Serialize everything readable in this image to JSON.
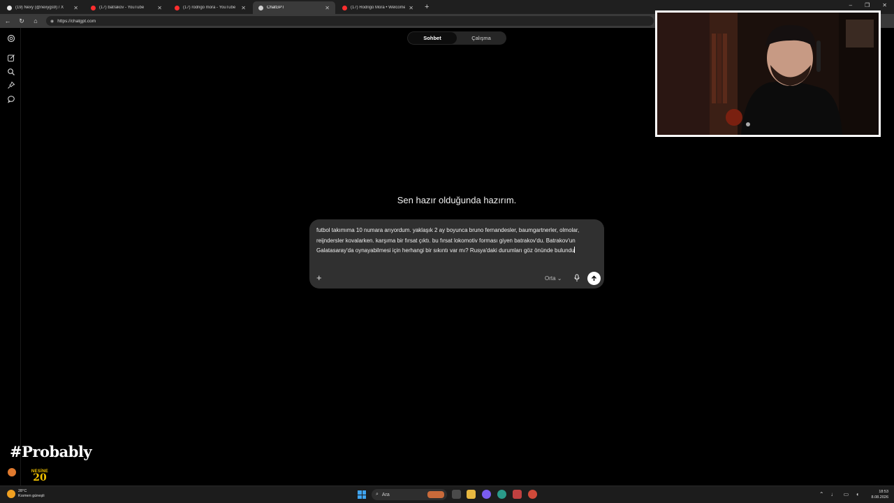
{
  "browser": {
    "tabs": [
      {
        "title": "(19) Nexy (@nexygs9) / X",
        "favicon_color": "#e6e6e6"
      },
      {
        "title": "(17) batrakov - YouTube",
        "favicon_color": "#ff2e2e"
      },
      {
        "title": "(17) rodrigo mora - YouTube",
        "favicon_color": "#ff2e2e"
      },
      {
        "title": "ChatGPT",
        "favicon_color": "#cfcfcf"
      },
      {
        "title": "(17) Rodrigo Mora • Welcome to",
        "favicon_color": "#ff2e2e"
      }
    ],
    "active_tab": 3,
    "new_tab": "+",
    "url": "https://chatgpt.com"
  },
  "sidebar": {
    "icons": [
      "openai-logo-icon",
      "new-chat-icon",
      "search-icon",
      "pin-icon",
      "chat-bubble-icon"
    ]
  },
  "mode_toggle": {
    "options": [
      "Sohbet",
      "Çalışma"
    ],
    "selected": "Sohbet"
  },
  "hero": {
    "heading": "Sen hazır olduğunda hazırım."
  },
  "composer": {
    "text": "futbol takımıma 10 numara arıyordum. yaklaşık 2 ay boyunca bruno fernandesler, baumgartnerler, olmolar, reijndersler kovalarken. karşıma bir fırsat çıktı. bu fırsat lokomotiv forması giyen batrakov'du. Batrakov'un Galatasaray'da oynayabilmesi için herhangi bir sıkıntı var mı? Rusya'daki durumları göz önünde bulundu",
    "model_label": "Orta"
  },
  "overlay": {
    "hashtag": "#Probably",
    "sponsor_name": "NESİNE",
    "sponsor_number": "20"
  },
  "taskbar": {
    "temperature": "28°C",
    "weather_text": "Kısmen güneşli",
    "search_label": "Ara",
    "time": "18:53",
    "date": "8.08.2026"
  },
  "colors": {
    "accent_send": "#ffffff",
    "composer_bg": "#303030",
    "page_bg": "#000000",
    "youtube_red": "#ff2e2e",
    "sponsor_yellow": "#f4c400"
  }
}
